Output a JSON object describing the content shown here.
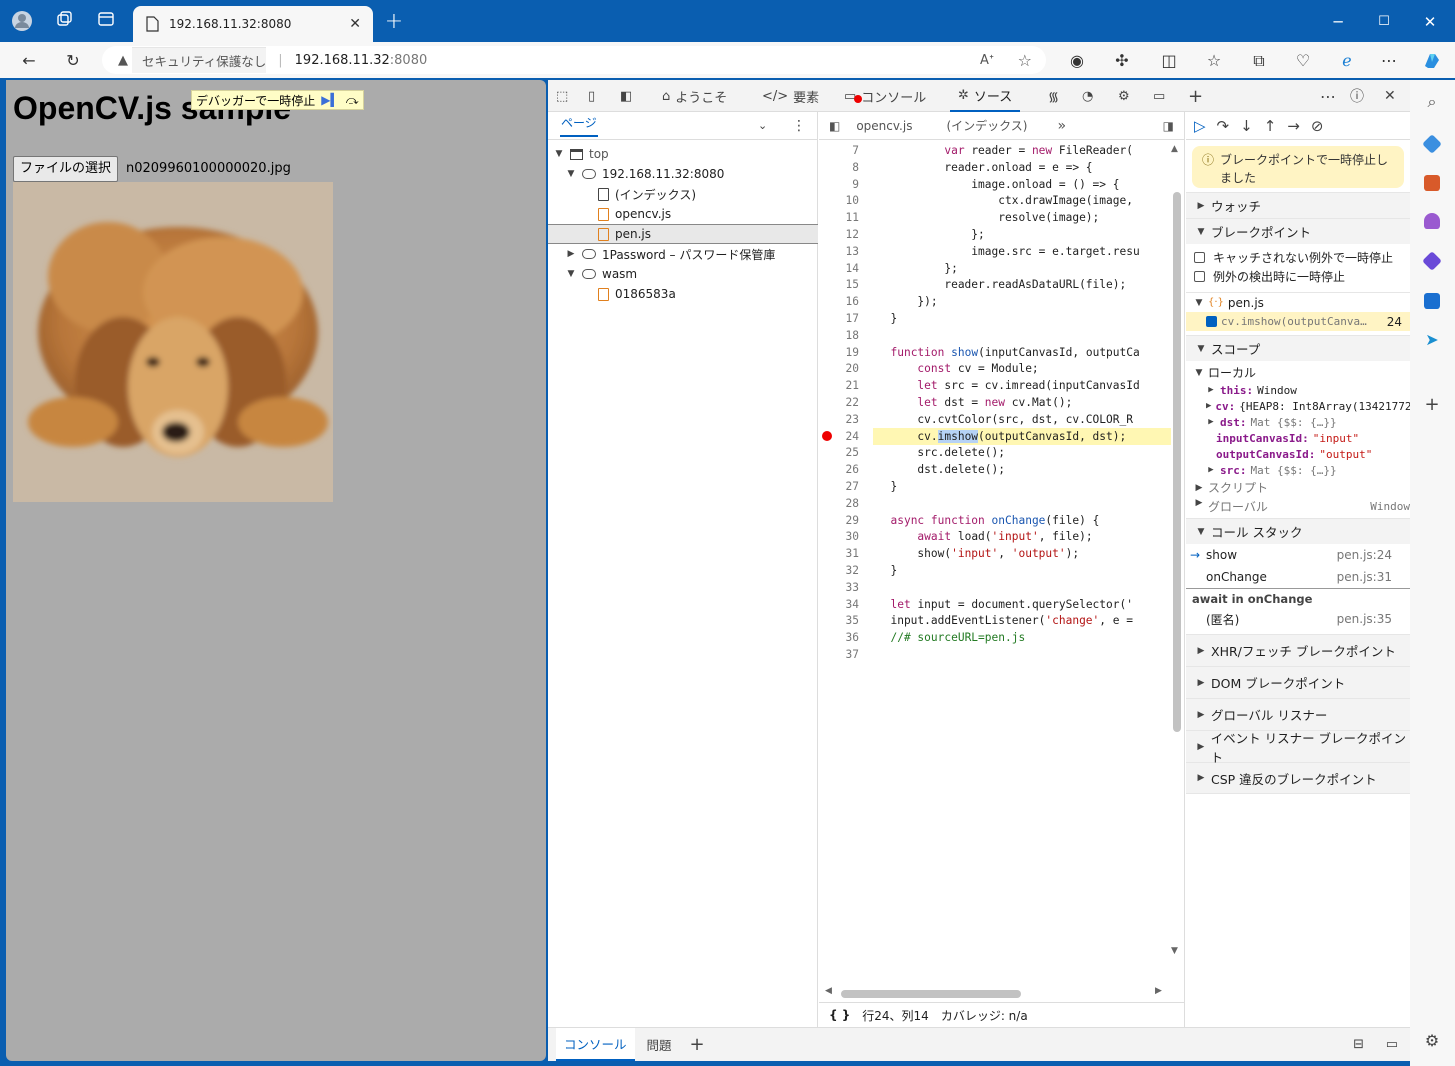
{
  "browser": {
    "tab_title": "192.168.11.32:8080",
    "address_warning": "セキュリティ保護なし",
    "address_host": "192.168.11.32",
    "address_port": ":8080"
  },
  "page": {
    "heading": "OpenCV.js sample",
    "debugger_badge": "デバッガーで一時停止",
    "file_button": "ファイルの選択",
    "file_name": "n0209960100000020.jpg"
  },
  "devtools": {
    "tabs": {
      "welcome": "ようこそ",
      "elements": "要素",
      "console": "コンソール",
      "sources": "ソース"
    },
    "navigator": {
      "tab": "ページ",
      "items": {
        "top": "top",
        "host": "192.168.11.32:8080",
        "index": "(インデックス)",
        "opencv": "opencv.js",
        "pen": "pen.js",
        "onepassword": "1Password – パスワード保管庫",
        "wasm": "wasm",
        "wasm_file": "0186583a"
      }
    },
    "editor": {
      "tab1": "opencv.js",
      "tab2": "(インデックス)",
      "status_position": "行24、列14",
      "status_coverage": "カバレッジ: n/a"
    },
    "sidebar": {
      "paused": "ブレークポイントで一時停止しました",
      "watch": "ウォッチ",
      "breakpoints": "ブレークポイント",
      "uncaught": "キャッチされない例外で一時停止",
      "caught": "例外の検出時に一時停止",
      "bp_file": "pen.js",
      "bp_code": "cv.imshow(outputCanva…",
      "bp_line": "24",
      "scope": "スコープ",
      "local": "ローカル",
      "scope_vars": {
        "this_key": "this:",
        "this_val": "Window",
        "cv_key": "cv:",
        "cv_val": "{HEAP8: Int8Array(13421772",
        "dst_key": "dst:",
        "dst_val": "Mat {$$: {…}}",
        "input_key": "inputCanvasId:",
        "input_val": "\"input\"",
        "output_key": "outputCanvasId:",
        "output_val": "\"output\"",
        "src_key": "src:",
        "src_val": "Mat {$$: {…}}"
      },
      "script": "スクリプト",
      "global": "グローバル",
      "global_val": "Window",
      "callstack": "コール スタック",
      "frames": [
        {
          "name": "show",
          "loc": "pen.js:24"
        },
        {
          "name": "onChange",
          "loc": "pen.js:31"
        },
        {
          "name": "await in onChange",
          "loc": ""
        },
        {
          "name": "(匿名)",
          "loc": "pen.js:35"
        }
      ],
      "xhr": "XHR/フェッチ ブレークポイント",
      "dom": "DOM ブレークポイント",
      "global_listeners": "グローバル リスナー",
      "event_listeners": "イベント リスナー ブレークポイント",
      "csp": "CSP 違反のブレークポイント"
    },
    "drawer": {
      "console": "コンソール",
      "issues": "問題"
    }
  },
  "colors": {
    "titlebar": "#0a5eb0",
    "accent": "#0060c0",
    "highlight_line": "#fff7b3",
    "breakpoint": "#e00000"
  }
}
